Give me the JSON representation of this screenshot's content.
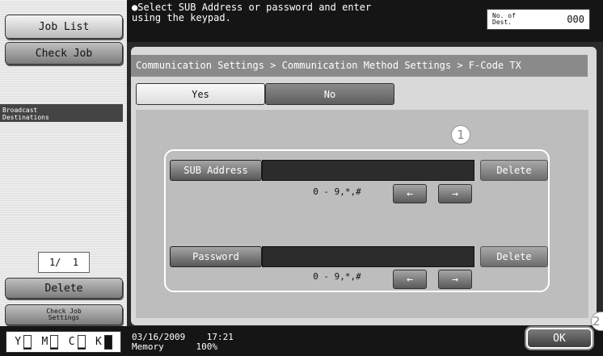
{
  "sidebar": {
    "job_list": "Job List",
    "check_job": "Check Job",
    "broadcast_title": "Broadcast\nDestinations",
    "page_counter": "1/  1",
    "delete": "Delete",
    "check_job_settings": "Check Job\nSettings",
    "toner": [
      "Y",
      "M",
      "C",
      "K"
    ],
    "toner_levels": [
      0.1,
      0.1,
      0.1,
      1.0
    ]
  },
  "header": {
    "message": "Select SUB Address or password and enter\nusing the keypad.",
    "dest_label": "No. of\nDest.",
    "dest_count": "000"
  },
  "breadcrumb": "Communication Settings > Communication Method Settings > F-Code TX",
  "tabs": [
    {
      "label": "Yes",
      "selected": false
    },
    {
      "label": "No",
      "selected": true
    }
  ],
  "form": {
    "callout": "1",
    "sub_address": {
      "label": "SUB Address",
      "value": "",
      "range": "0 - 9,*,#",
      "delete": "Delete"
    },
    "password": {
      "label": "Password",
      "value": "",
      "range": "0 - 9,*,#",
      "delete": "Delete"
    },
    "arrow_left": "←",
    "arrow_right": "→"
  },
  "footer": {
    "date": "03/16/2009",
    "time": "17:21",
    "memory_label": "Memory",
    "memory_value": "100%",
    "ok": "OK",
    "callout": "2"
  }
}
